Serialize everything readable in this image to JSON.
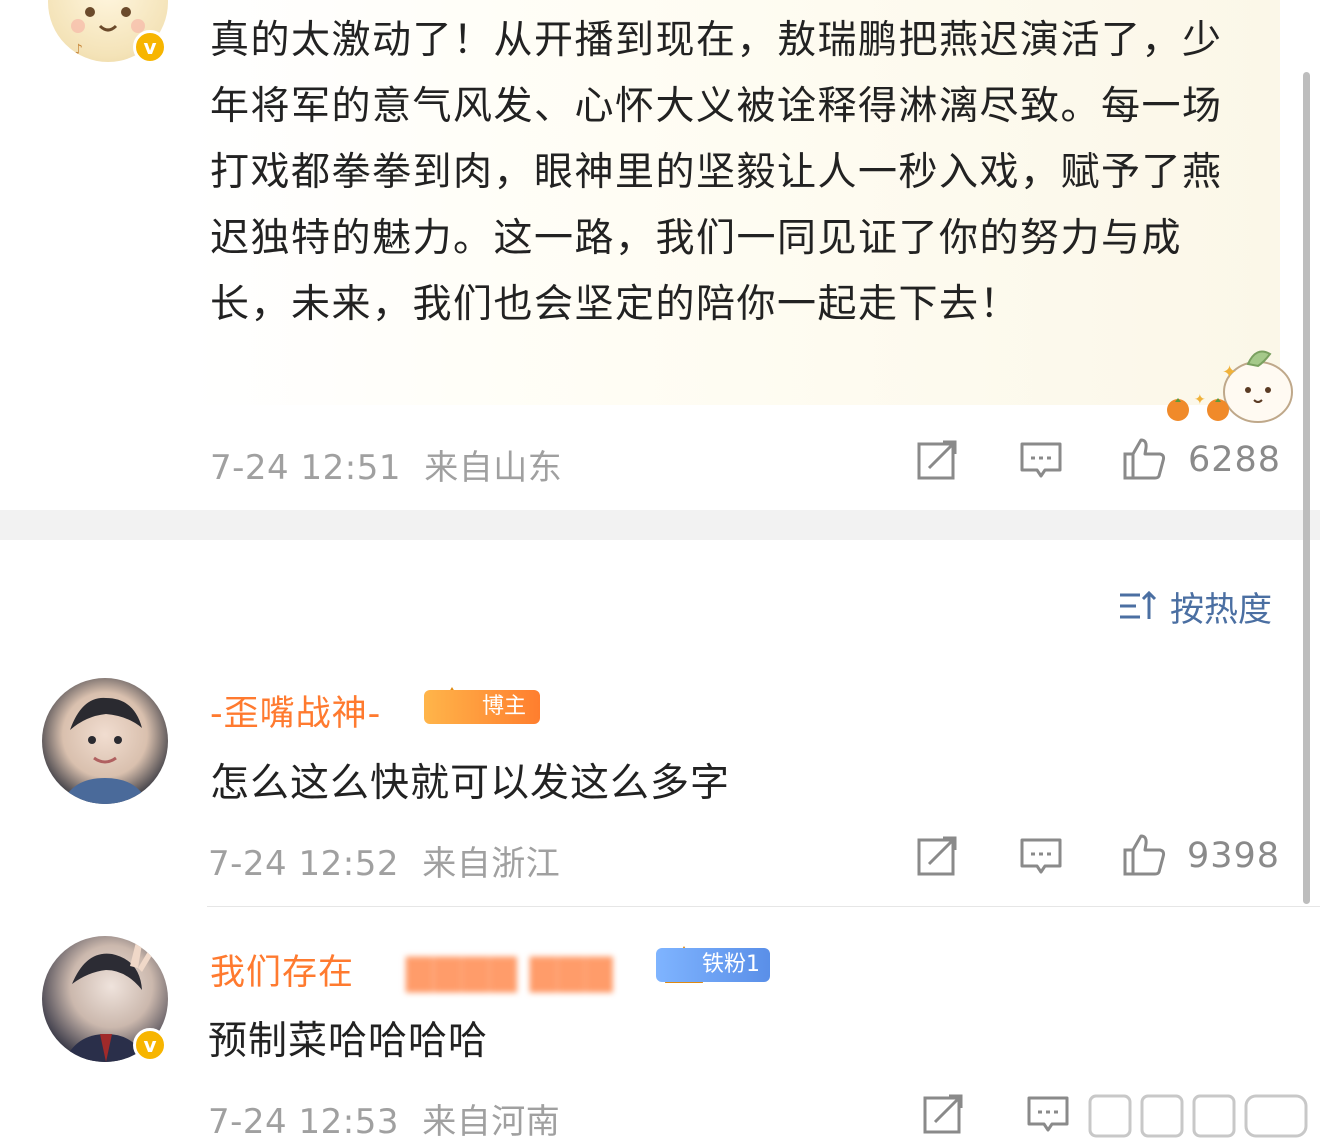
{
  "post": {
    "text": "真的太激动了！从开播到现在，敖瑞鹏把燕迟演活了，少年将军的意气风发、心怀大义被诠释得淋漓尽致。每一场打戏都拳拳到肉，眼神里的坚毅让人一秒入戏，赋予了燕迟独特的魅力。这一路，我们一同见证了你的努力与成长，未来，我们也会坚定的陪你一起走下去！",
    "time": "7-24 12:51",
    "location": "来自山东",
    "likes": "6288"
  },
  "sort_label": "按热度",
  "comments": [
    {
      "name": "-歪嘴战神-",
      "tag": "博主",
      "text": "怎么这么快就可以发这么多字",
      "time": "7-24 12:52",
      "location": "来自浙江",
      "likes": "9398"
    },
    {
      "name": "我们存在",
      "tag": "铁粉1",
      "text": "预制菜哈哈哈哈",
      "time": "7-24 12:53",
      "location": "来自河南"
    }
  ],
  "colors": {
    "accent_orange": "#ff7a2f",
    "link_blue": "#4b6fa2",
    "muted": "#a0a0a0",
    "verified": "#f7b500"
  },
  "icons": [
    "share-icon",
    "comment-icon",
    "like-icon",
    "sort-icon",
    "verified-icon",
    "crown-icon"
  ]
}
